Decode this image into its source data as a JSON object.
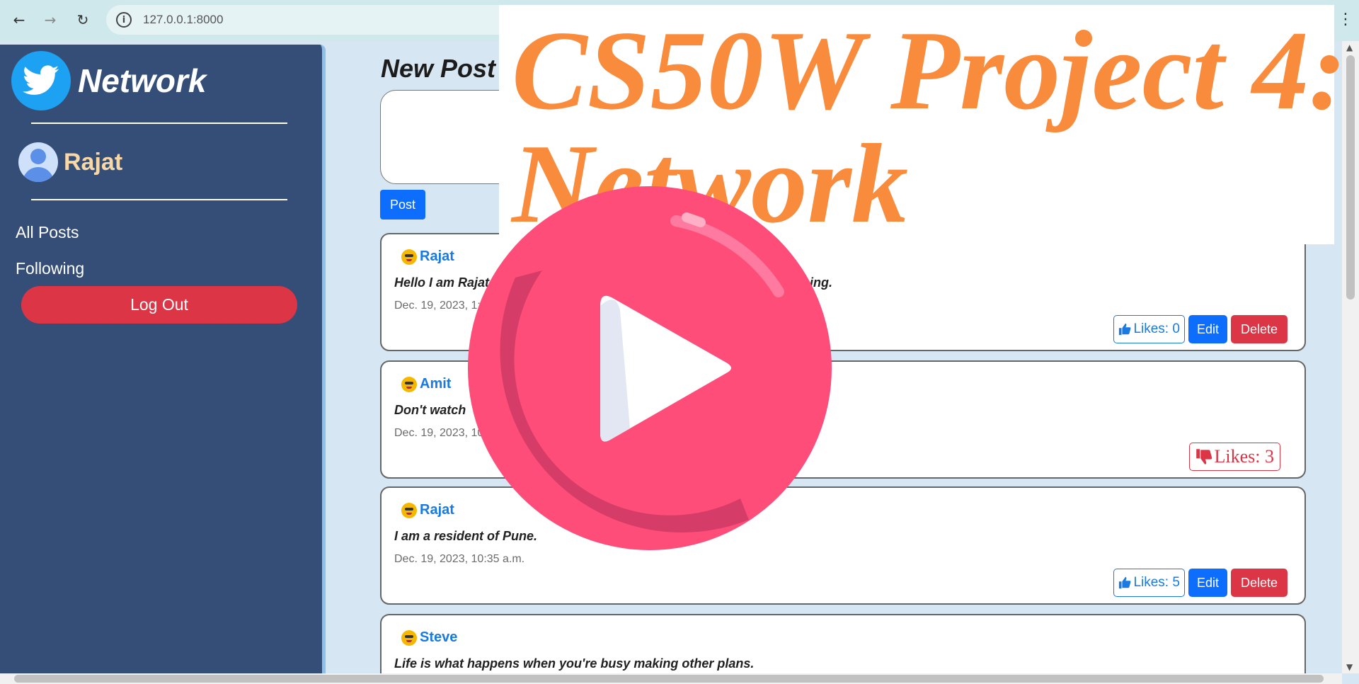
{
  "browser": {
    "url": "127.0.0.1:8000"
  },
  "sidebar": {
    "brand": "Network",
    "username": "Rajat",
    "links": [
      "All Posts",
      "Following"
    ],
    "logout_label": "Log Out"
  },
  "main": {
    "new_post_heading": "New Post",
    "post_button_label": "Post",
    "posts": [
      {
        "author": "Rajat",
        "content": "Hello I am Rajat",
        "content_tail": "ing.",
        "timestamp": "Dec. 19, 2023, 1:",
        "likes_label": "Likes: 0",
        "edit_label": "Edit",
        "delete_label": "Delete"
      },
      {
        "author": "Amit",
        "content": "Don't watch",
        "timestamp": "Dec. 19, 2023, 10",
        "likes_label": "Likes: 3"
      },
      {
        "author": "Rajat",
        "content": "I am a resident of Pune.",
        "timestamp": "Dec. 19, 2023, 10:35 a.m.",
        "likes_label": "Likes: 5",
        "edit_label": "Edit",
        "delete_label": "Delete"
      },
      {
        "author": "Steve",
        "content": "Life is what happens when you're busy making other plans."
      }
    ]
  },
  "overlay": {
    "banner_line1": "CS50W Project 4:",
    "banner_line2": "Network",
    "play_color": "#ff4d7a"
  }
}
